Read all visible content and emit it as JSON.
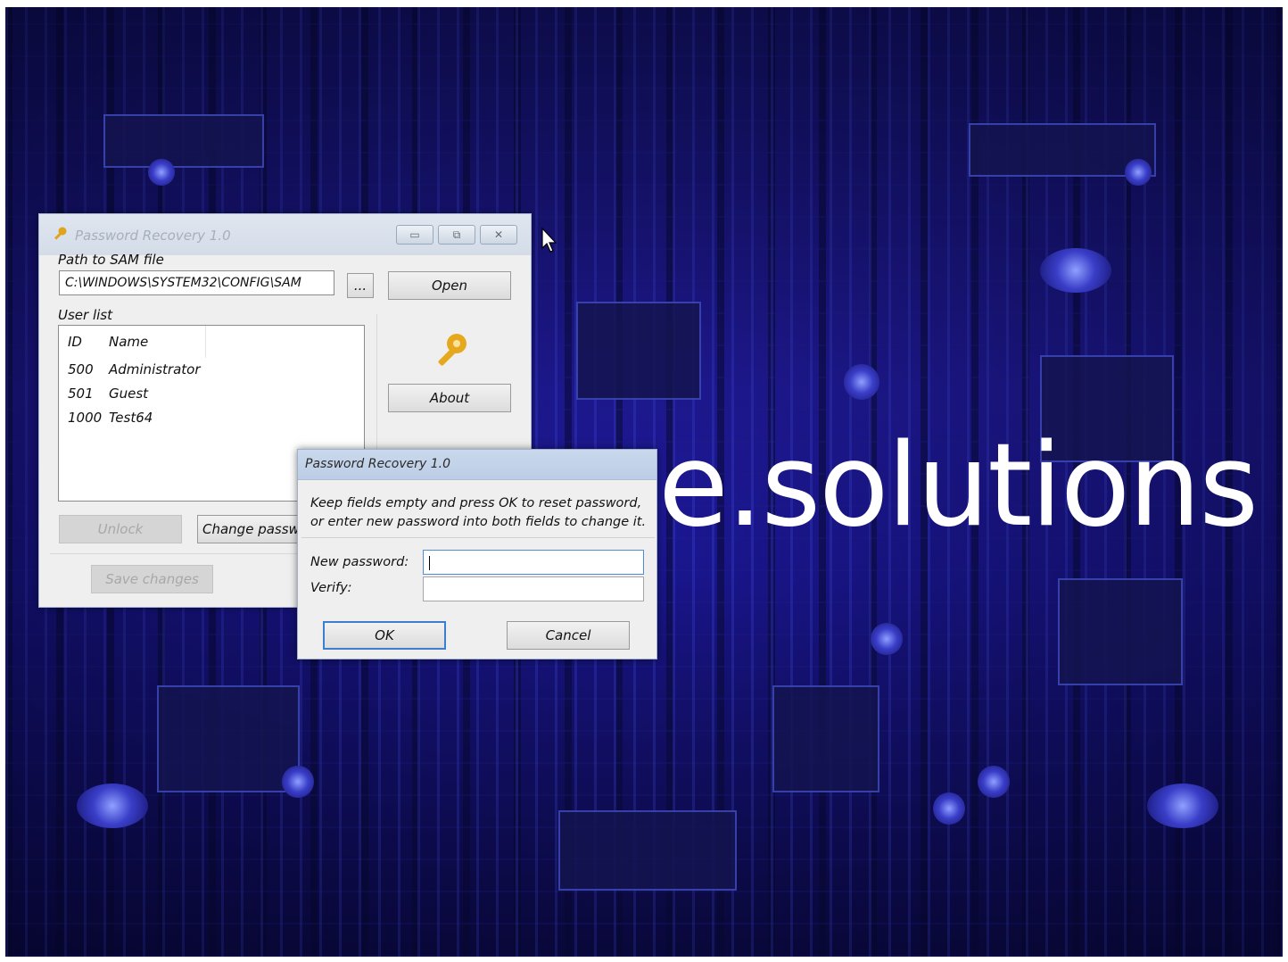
{
  "desktop": {
    "brand_text": "e.solutions"
  },
  "main_window": {
    "title": "Password Recovery 1.0",
    "controls": {
      "minimize": "▭",
      "maximize": "⧉",
      "close": "✕"
    },
    "path_label": "Path to SAM file",
    "path_value": "C:\\WINDOWS\\SYSTEM32\\CONFIG\\SAM",
    "browse_label": "...",
    "open_label": "Open",
    "user_list_label": "User list",
    "columns": {
      "id": "ID",
      "name": "Name"
    },
    "users": [
      {
        "id": "500",
        "name": "Administrator"
      },
      {
        "id": "501",
        "name": "Guest"
      },
      {
        "id": "1000",
        "name": "Test64"
      }
    ],
    "about_label": "About",
    "unlock_label": "Unlock",
    "change_password_label": "Change passw",
    "save_changes_label": "Save changes"
  },
  "dialog": {
    "title": "Password Recovery 1.0",
    "message_line1": "Keep fields empty and press OK to reset password,",
    "message_line2": "or enter new password into both fields to change it.",
    "new_password_label": "New password:",
    "verify_label": "Verify:",
    "new_password_value": "",
    "verify_value": "",
    "ok_label": "OK",
    "cancel_label": "Cancel"
  },
  "icons": {
    "title_icon": "key-icon",
    "about_icon": "key-icon",
    "cursor": "mouse-pointer-icon"
  },
  "colors": {
    "desktop_bg": "#1a1690",
    "window_bg": "#efefef",
    "title_bar": "#d4dce8",
    "focus_border": "#4f8ed6",
    "key_gold": "#e0a41c"
  }
}
